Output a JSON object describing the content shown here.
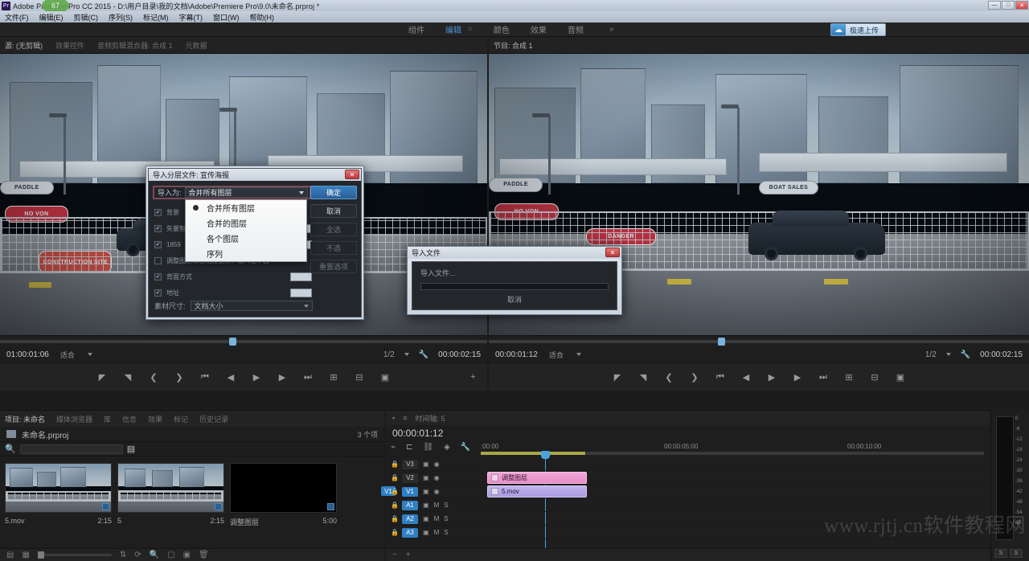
{
  "titlebar": {
    "app_badge": "Pr",
    "title": "Adobe Premiere Pro CC 2015 - D:\\用户目录\\我的文档\\Adobe\\Premiere Pro\\9.0\\未命名.prproj *",
    "win_badge": "67",
    "minimize": "—",
    "maximize": "□",
    "close": "✕"
  },
  "menubar": {
    "items": [
      {
        "label": "文件(F)"
      },
      {
        "label": "编辑(E)"
      },
      {
        "label": "剪辑(C)"
      },
      {
        "label": "序列(S)"
      },
      {
        "label": "标记(M)"
      },
      {
        "label": "字幕(T)"
      },
      {
        "label": "窗口(W)"
      },
      {
        "label": "帮助(H)"
      }
    ]
  },
  "workspace": {
    "handle": "≡",
    "tabs": [
      {
        "label": "组件",
        "active": false
      },
      {
        "label": "编辑",
        "active": true
      },
      {
        "label": "颜色",
        "active": false
      },
      {
        "label": "效果",
        "active": false
      },
      {
        "label": "音频",
        "active": false
      }
    ],
    "more": "»",
    "upload_label": "极速上传",
    "upload_icon": "☁"
  },
  "source_monitor": {
    "tabs": [
      {
        "label": "源: (无剪辑)"
      },
      {
        "label": "效果控件"
      },
      {
        "label": "音频剪辑混合器: 合成 1"
      },
      {
        "label": "元数据"
      }
    ],
    "current_time": "01:00:01:06",
    "fit": "适合",
    "zoom": "1/2",
    "duration": "00:00:02:15",
    "tools": [
      "标记入点",
      "标记出点",
      "添加标记",
      "转到入点",
      "后退一帧",
      "播放",
      "前进一帧",
      "转到出点",
      "插入",
      "覆盖",
      "导出帧"
    ]
  },
  "program_monitor": {
    "tabs": [
      {
        "label": "节目: 合成 1"
      }
    ],
    "current_time": "00:00:01:12",
    "fit": "适合",
    "zoom": "1/2",
    "duration": "00:00:02:15"
  },
  "project_panel": {
    "tabs": [
      {
        "label": "项目: 未命名",
        "active": true
      },
      {
        "label": "媒体浏览器",
        "active": false
      },
      {
        "label": "库",
        "active": false
      },
      {
        "label": "信息",
        "active": false
      },
      {
        "label": "效果",
        "active": false
      },
      {
        "label": "标记",
        "active": false
      },
      {
        "label": "历史记录",
        "active": false
      }
    ],
    "project_name": "未命名.prproj",
    "item_count": "3 个项",
    "search_placeholder": "",
    "items": [
      {
        "name": "5.mov",
        "duration": "2:15",
        "kind": "video"
      },
      {
        "name": "5",
        "duration": "2:15",
        "kind": "sequence"
      },
      {
        "name": "调整图层",
        "duration": "5:00",
        "kind": "adjustment"
      }
    ],
    "zoom_level": ""
  },
  "timeline_panel": {
    "tabs": [
      {
        "label": "时间轴: 5"
      }
    ],
    "current_time": "00:00:01:12",
    "ruler_labels": [
      ":00:00",
      "00:00:05:00",
      "00:00:10:00"
    ],
    "tools": [
      "嵌套序列",
      "对齐",
      "链接选择",
      "添加标记",
      "时间轴显示设置"
    ],
    "tracks": [
      {
        "name": "V3",
        "type": "video",
        "targeted": false
      },
      {
        "name": "V2",
        "type": "video",
        "targeted": false
      },
      {
        "name": "V1",
        "type": "video",
        "targeted": true
      },
      {
        "name": "A1",
        "type": "audio",
        "targeted": true
      },
      {
        "name": "A2",
        "type": "audio",
        "targeted": true
      },
      {
        "name": "A3",
        "type": "audio",
        "targeted": true
      }
    ],
    "source_chip": "V1",
    "clips": [
      {
        "label": "调整图层",
        "track": "V2",
        "color": "pink"
      },
      {
        "label": "5.mov",
        "track": "V1",
        "color": "purple"
      }
    ]
  },
  "audio_meter": {
    "ticks": [
      "0",
      "-6",
      "-12",
      "-18",
      "-24",
      "-30",
      "-36",
      "-42",
      "-48",
      "-54",
      "dB"
    ],
    "buttons": [
      "S",
      "S"
    ]
  },
  "layered_dialog": {
    "title": "导入分层文件: 宣传海报",
    "close": "✕",
    "import_as_label": "导入为:",
    "import_as_value": "合并所有图层",
    "dropdown_options": [
      {
        "label": "合并所有图层",
        "selected": true
      },
      {
        "label": "合并的图层",
        "selected": false
      },
      {
        "label": "各个图层",
        "selected": false
      },
      {
        "label": "序列",
        "selected": false
      }
    ],
    "checkboxes": [
      {
        "label": "背景",
        "checked": true,
        "value": ""
      },
      {
        "label": "矢量智能对象",
        "checked": true,
        "value": ""
      },
      {
        "label": "1859",
        "checked": true,
        "value": ""
      },
      {
        "label": "调整图层请在相应上方，或人在下面",
        "checked": false,
        "value": ""
      },
      {
        "label": "背面方式",
        "checked": true,
        "value": ""
      },
      {
        "label": "地址",
        "checked": true,
        "value": ""
      }
    ],
    "size_label": "素材尺寸:",
    "size_value": "文档大小",
    "buttons": [
      {
        "label": "确定",
        "style": "primary"
      },
      {
        "label": "取消",
        "style": "normal"
      },
      {
        "label": "全选",
        "style": "dim"
      },
      {
        "label": "不选",
        "style": "dim"
      },
      {
        "label": "重置选项",
        "style": "dim"
      }
    ]
  },
  "progress_dialog": {
    "title": "导入文件",
    "close": "✕",
    "message": "导入文件...",
    "cancel_label": "取消"
  },
  "watermark": {
    "text": "www.rjtj.cn软件教程网"
  },
  "colors": {
    "accent_blue": "#2f7fc4",
    "clip_pink": "#e88cc8",
    "clip_purple": "#a89be0",
    "ruler_yellow": "#a8a848",
    "playhead": "#4aa3dd"
  }
}
